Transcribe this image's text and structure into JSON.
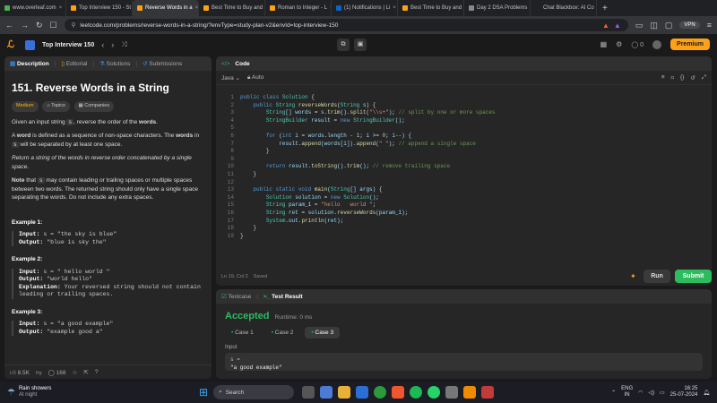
{
  "browser": {
    "tabs": [
      {
        "label": "www.overleaf.com",
        "color": "#4cae4f",
        "active": false
      },
      {
        "label": "Top Interview 150 - St",
        "color": "#ffa116",
        "active": false
      },
      {
        "label": "Reverse Words in a",
        "color": "#ffa116",
        "active": true
      },
      {
        "label": "Best Time to Buy and",
        "color": "#ffa116",
        "active": false
      },
      {
        "label": "Roman to Integer - L",
        "color": "#ffa116",
        "active": false
      },
      {
        "label": "(1) Notifications | Li",
        "color": "#0a66c2",
        "active": false
      },
      {
        "label": "Best Time to Buy and",
        "color": "#ffa116",
        "active": false
      },
      {
        "label": "Day 2 DSA Problems",
        "color": "#888888",
        "active": false
      },
      {
        "label": "Chat Blackbox: AI Co",
        "color": "#222222",
        "active": false
      }
    ],
    "url": "leetcode.com/problems/reverse-words-in-a-string/?envType=study-plan-v2&envId=top-interview-150",
    "vpn": "VPN"
  },
  "header": {
    "study_plan": "Top Interview 150",
    "streak": "0",
    "premium": "Premium"
  },
  "left": {
    "tabs": [
      "Description",
      "Editorial",
      "Solutions",
      "Submissions"
    ],
    "title": "151. Reverse Words in a String",
    "chips": [
      "Medium",
      "Topics",
      "Companies"
    ],
    "p1a": "Given an input string ",
    "p1code": "s",
    "p1b": ", reverse the order of the ",
    "p1bold": "words",
    "p1c": ".",
    "p2a": "A ",
    "p2bold": "word",
    "p2b": " is defined as a sequence of non-space characters. The ",
    "p2bold2": "words",
    "p2c": " in ",
    "p2code": "s",
    "p2d": " will be separated by at least one space.",
    "p3": "Return a string of the words in reverse order concatenated by a single space.",
    "p4bold": "Note",
    "p4a": " that ",
    "p4code": "s",
    "p4b": " may contain leading or trailing spaces or multiple spaces between two words. The returned string should only have a single space separating the words. Do not include any extra spaces.",
    "examples": [
      {
        "title": "Example 1:",
        "input": "s = \"the sky is blue\"",
        "output": "\"blue is sky the\"",
        "explanation": ""
      },
      {
        "title": "Example 2:",
        "input": "s = \"  hello world  \"",
        "output": "\"world hello\"",
        "explanation": "Your reversed string should not contain leading or trailing spaces."
      },
      {
        "title": "Example 3:",
        "input": "s = \"a good   example\"",
        "output": "\"example good a\"",
        "explanation": ""
      }
    ],
    "labels": {
      "input": "Input:",
      "output": "Output:",
      "explanation": "Explanation:"
    },
    "footer": {
      "likes": "8.5K",
      "comments": "168"
    }
  },
  "code": {
    "title": "Code",
    "lang": "Java",
    "auto": "Auto",
    "status": "Ln 19, Col 2",
    "saved": "Saved",
    "run": "Run",
    "submit": "Submit"
  },
  "result": {
    "tabs": [
      "Testcase",
      "Test Result"
    ],
    "accepted": "Accepted",
    "runtime": "Runtime: 0 ms",
    "cases": [
      "Case 1",
      "Case 2",
      "Case 3"
    ],
    "input_label": "Input",
    "var": "s =",
    "value": "\"a good   example\""
  },
  "taskbar": {
    "weather": "Rain showers",
    "weather_sub": "At night",
    "search": "Search",
    "lang1": "ENG",
    "lang2": "IN",
    "time": "16:25",
    "date": "25-07-2024"
  }
}
